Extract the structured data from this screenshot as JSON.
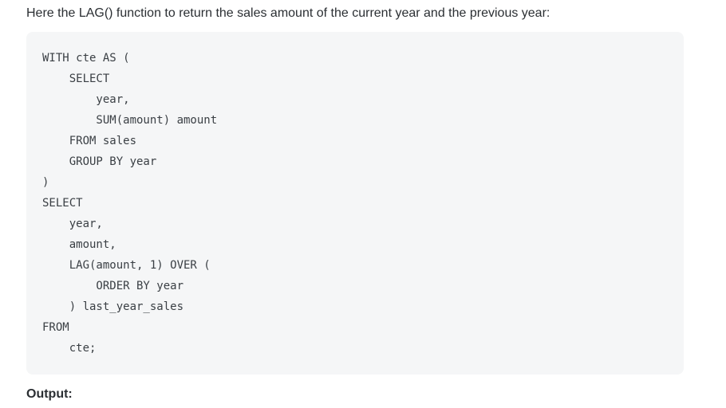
{
  "intro_text": "Here the LAG() function to return the sales amount of the current year and the previous year:",
  "code_lines": [
    "WITH cte AS (",
    "    SELECT",
    "        year,",
    "        SUM(amount) amount",
    "    FROM sales",
    "    GROUP BY year",
    ")",
    "SELECT",
    "    year,",
    "    amount,",
    "    LAG(amount, 1) OVER (",
    "        ORDER BY year",
    "    ) last_year_sales",
    "FROM",
    "    cte;"
  ],
  "output_label": "Output:"
}
